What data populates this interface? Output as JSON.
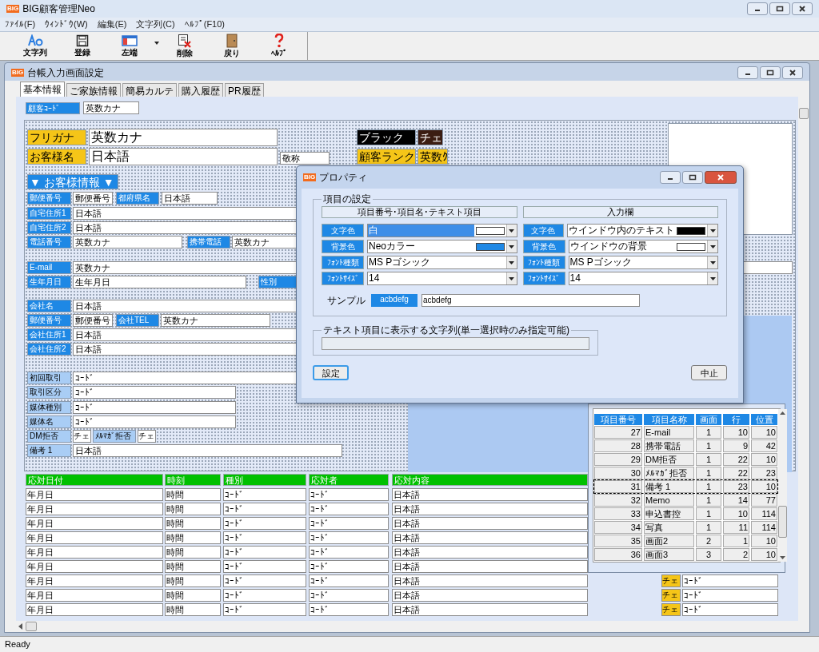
{
  "app": {
    "logo": "BIG",
    "title": "BIG顧客管理Neo"
  },
  "menu": [
    "ﾌｧｲﾙ(F)",
    "ｳｨﾝﾄﾞｳ(W)",
    "編集(E)",
    "文字列(C)",
    "ﾍﾙﾌﾟ(F10)"
  ],
  "toolbar": [
    {
      "kind": "font",
      "label": "文字列",
      "dropdown": false
    },
    {
      "kind": "save",
      "label": "登録",
      "dropdown": false
    },
    {
      "kind": "window",
      "label": "左端",
      "dropdown": true
    },
    {
      "kind": "delete",
      "label": "削除",
      "dropdown": false
    },
    {
      "kind": "door",
      "label": "戻り",
      "dropdown": false
    },
    {
      "kind": "help",
      "label": "ﾍﾙﾌﾟ",
      "dropdown": false
    }
  ],
  "child_window": {
    "logo": "BIG",
    "title": "台帳入力画面設定",
    "tabs": [
      {
        "label": "基本情報",
        "selected": true
      },
      {
        "label": "ご家族情報",
        "selected": false
      },
      {
        "label": "簡易カルテ",
        "selected": false
      },
      {
        "label": "購入履歴",
        "selected": false
      },
      {
        "label": "PR履歴",
        "selected": false
      }
    ]
  },
  "form": {
    "items": [
      {
        "kind": "label",
        "color": "#1e88e5",
        "text": "顧客ｺｰﾄﾞ"
      },
      {
        "kind": "field",
        "text": "英数カナ"
      },
      {
        "kind": "label",
        "color": "#f5c518",
        "text": "フリガナ"
      },
      {
        "kind": "field",
        "text": "英数カナ"
      },
      {
        "kind": "label",
        "color": "#f5c518",
        "text": "お客様名"
      },
      {
        "kind": "field",
        "text": "日本語"
      },
      {
        "kind": "field",
        "text": "敬称"
      },
      {
        "kind": "label",
        "color": "#000000",
        "text": "ブラック"
      },
      {
        "kind": "label",
        "color": "#3b1d12",
        "text": "チェ"
      },
      {
        "kind": "label",
        "color": "#f5c518",
        "text": "顧客ランク"
      },
      {
        "kind": "label",
        "color": "#f5c518",
        "text": "英数ｸ"
      },
      {
        "kind": "header",
        "color": "#1e88e5",
        "text": "▼ お客様情報 ▼"
      },
      {
        "kind": "label",
        "color": "#1e88e5",
        "text": "郵便番号"
      },
      {
        "kind": "field",
        "text": "郵便番号"
      },
      {
        "kind": "label",
        "color": "#1e88e5",
        "text": "都府県名"
      },
      {
        "kind": "field",
        "text": "日本語"
      },
      {
        "kind": "label",
        "color": "#1e88e5",
        "text": "自宅住所1"
      },
      {
        "kind": "field",
        "text": "日本語"
      },
      {
        "kind": "label",
        "color": "#1e88e5",
        "text": "自宅住所2"
      },
      {
        "kind": "field",
        "text": "日本語"
      },
      {
        "kind": "label",
        "color": "#1e88e5",
        "text": "電話番号"
      },
      {
        "kind": "field",
        "text": "英数カナ"
      },
      {
        "kind": "label",
        "color": "#1e88e5",
        "text": "携帯電話"
      },
      {
        "kind": "field",
        "text": "英数カナ"
      },
      {
        "kind": "label",
        "color": "#1e88e5",
        "text": "E-mail"
      },
      {
        "kind": "field",
        "text": "英数カナ"
      },
      {
        "kind": "label",
        "color": "#1e88e5",
        "text": "生年月日"
      },
      {
        "kind": "field",
        "text": "生年月日"
      },
      {
        "kind": "label",
        "color": "#1e88e5",
        "text": "性別"
      },
      {
        "kind": "label",
        "color": "#1e88e5",
        "text": "会社名"
      },
      {
        "kind": "field",
        "text": "日本語"
      },
      {
        "kind": "label",
        "color": "#1e88e5",
        "text": "郵便番号"
      },
      {
        "kind": "field",
        "text": "郵便番号"
      },
      {
        "kind": "label",
        "color": "#1e88e5",
        "text": "会社TEL"
      },
      {
        "kind": "field",
        "text": "英数カナ"
      },
      {
        "kind": "label",
        "color": "#1e88e5",
        "text": "会社住所1"
      },
      {
        "kind": "field",
        "text": "日本語"
      },
      {
        "kind": "label",
        "color": "#1e88e5",
        "text": "会社住所2"
      },
      {
        "kind": "field",
        "text": "日本語"
      },
      {
        "kind": "label",
        "color": "#a9cdf5",
        "text": "初回取引"
      },
      {
        "kind": "field",
        "text": "ｺｰﾄﾞ"
      },
      {
        "kind": "label",
        "color": "#a9cdf5",
        "text": "取引区分"
      },
      {
        "kind": "field",
        "text": "ｺｰﾄﾞ"
      },
      {
        "kind": "label",
        "color": "#a9cdf5",
        "text": "媒体種別"
      },
      {
        "kind": "field",
        "text": "ｺｰﾄﾞ"
      },
      {
        "kind": "label",
        "color": "#a9cdf5",
        "text": "媒体名"
      },
      {
        "kind": "field",
        "text": "ｺｰﾄﾞ"
      },
      {
        "kind": "label",
        "color": "#a9cdf5",
        "text": "DM拒否"
      },
      {
        "kind": "field",
        "text": "チェ"
      },
      {
        "kind": "label",
        "color": "#a9cdf5",
        "text": "ﾒﾙﾏｶﾞ拒否"
      },
      {
        "kind": "field",
        "text": "チェ"
      },
      {
        "kind": "label",
        "color": "#a9cdf5",
        "text": "備考 1"
      },
      {
        "kind": "field",
        "text": "日本語"
      }
    ]
  },
  "history": {
    "columns": [
      "応対日付",
      "時刻",
      "種別",
      "応対者",
      "応対内容"
    ],
    "rows": [
      [
        "年月日",
        "時間",
        "ｺｰﾄﾞ",
        "ｺｰﾄﾞ",
        "日本語"
      ],
      [
        "年月日",
        "時間",
        "ｺｰﾄﾞ",
        "ｺｰﾄﾞ",
        "日本語"
      ],
      [
        "年月日",
        "時間",
        "ｺｰﾄﾞ",
        "ｺｰﾄﾞ",
        "日本語"
      ],
      [
        "年月日",
        "時間",
        "ｺｰﾄﾞ",
        "ｺｰﾄﾞ",
        "日本語"
      ],
      [
        "年月日",
        "時間",
        "ｺｰﾄﾞ",
        "ｺｰﾄﾞ",
        "日本語"
      ],
      [
        "年月日",
        "時間",
        "ｺｰﾄﾞ",
        "ｺｰﾄﾞ",
        "日本語"
      ],
      [
        "年月日",
        "時間",
        "ｺｰﾄﾞ",
        "ｺｰﾄﾞ",
        "日本語",
        "チェ",
        "ｺｰﾄﾞ"
      ],
      [
        "年月日",
        "時間",
        "ｺｰﾄﾞ",
        "ｺｰﾄﾞ",
        "日本語",
        "チェ",
        "ｺｰﾄﾞ"
      ],
      [
        "年月日",
        "時間",
        "ｺｰﾄﾞ",
        "ｺｰﾄﾞ",
        "日本語",
        "チェ",
        "ｺｰﾄﾞ"
      ]
    ]
  },
  "item_list": {
    "columns": [
      "項目番号",
      "項目名称",
      "画面",
      "行",
      "位置"
    ],
    "rows": [
      {
        "cells": [
          "27",
          "E-mail",
          "1",
          "10",
          "10"
        ],
        "selected": false
      },
      {
        "cells": [
          "28",
          "携帯電話",
          "1",
          "9",
          "42"
        ],
        "selected": false
      },
      {
        "cells": [
          "29",
          "DM拒否",
          "1",
          "22",
          "10"
        ],
        "selected": false
      },
      {
        "cells": [
          "30",
          "ﾒﾙﾏｶﾞ拒否",
          "1",
          "22",
          "23"
        ],
        "selected": false
      },
      {
        "cells": [
          "31",
          "備考 1",
          "1",
          "23",
          "10"
        ],
        "selected": true
      },
      {
        "cells": [
          "32",
          "Memo",
          "1",
          "14",
          "77"
        ],
        "selected": false
      },
      {
        "cells": [
          "33",
          "申込書控",
          "1",
          "10",
          "114"
        ],
        "selected": false
      },
      {
        "cells": [
          "34",
          "写真",
          "1",
          "11",
          "114"
        ],
        "selected": false
      },
      {
        "cells": [
          "35",
          "画面2",
          "2",
          "1",
          "10"
        ],
        "selected": false
      },
      {
        "cells": [
          "36",
          "画面3",
          "3",
          "2",
          "10"
        ],
        "selected": false
      }
    ]
  },
  "properties_dialog": {
    "logo": "BIG",
    "title": "プロパティ",
    "group": "項目の設定",
    "columns": [
      {
        "header": "項目番号･項目名･テキスト項目",
        "rows": [
          {
            "label": "文字色",
            "value": "白",
            "color": "#ffffff",
            "highlighted": true
          },
          {
            "label": "背景色",
            "value": "Neoカラー",
            "color": "#1e88e5",
            "highlighted": false
          },
          {
            "label": "ﾌｫﾝﾄ種類",
            "value": "MS Pゴシック",
            "highlighted": false
          },
          {
            "label": "ﾌｫﾝﾄｻｲｽﾞ",
            "value": "14",
            "highlighted": false
          }
        ]
      },
      {
        "header": "入力欄",
        "rows": [
          {
            "label": "文字色",
            "value": "ウインドウ内のテキスト",
            "color": "#000000",
            "highlighted": false
          },
          {
            "label": "背景色",
            "value": "ウインドウの背景",
            "color": "#ffffff",
            "highlighted": false
          },
          {
            "label": "ﾌｫﾝﾄ種類",
            "value": "MS Pゴシック",
            "highlighted": false
          },
          {
            "label": "ﾌｫﾝﾄｻｲｽﾞ",
            "value": "14",
            "highlighted": false
          }
        ]
      }
    ],
    "sample_label": "サンプル",
    "sample_item": "acbdefg",
    "sample_input": "acbdefg",
    "text_group": "テキスト項目に表示する文字列(単一選択時のみ指定可能)",
    "buttons": [
      {
        "label": "設定",
        "focused": true
      },
      {
        "label": "中止",
        "focused": false
      }
    ]
  },
  "status_bar": "Ready"
}
